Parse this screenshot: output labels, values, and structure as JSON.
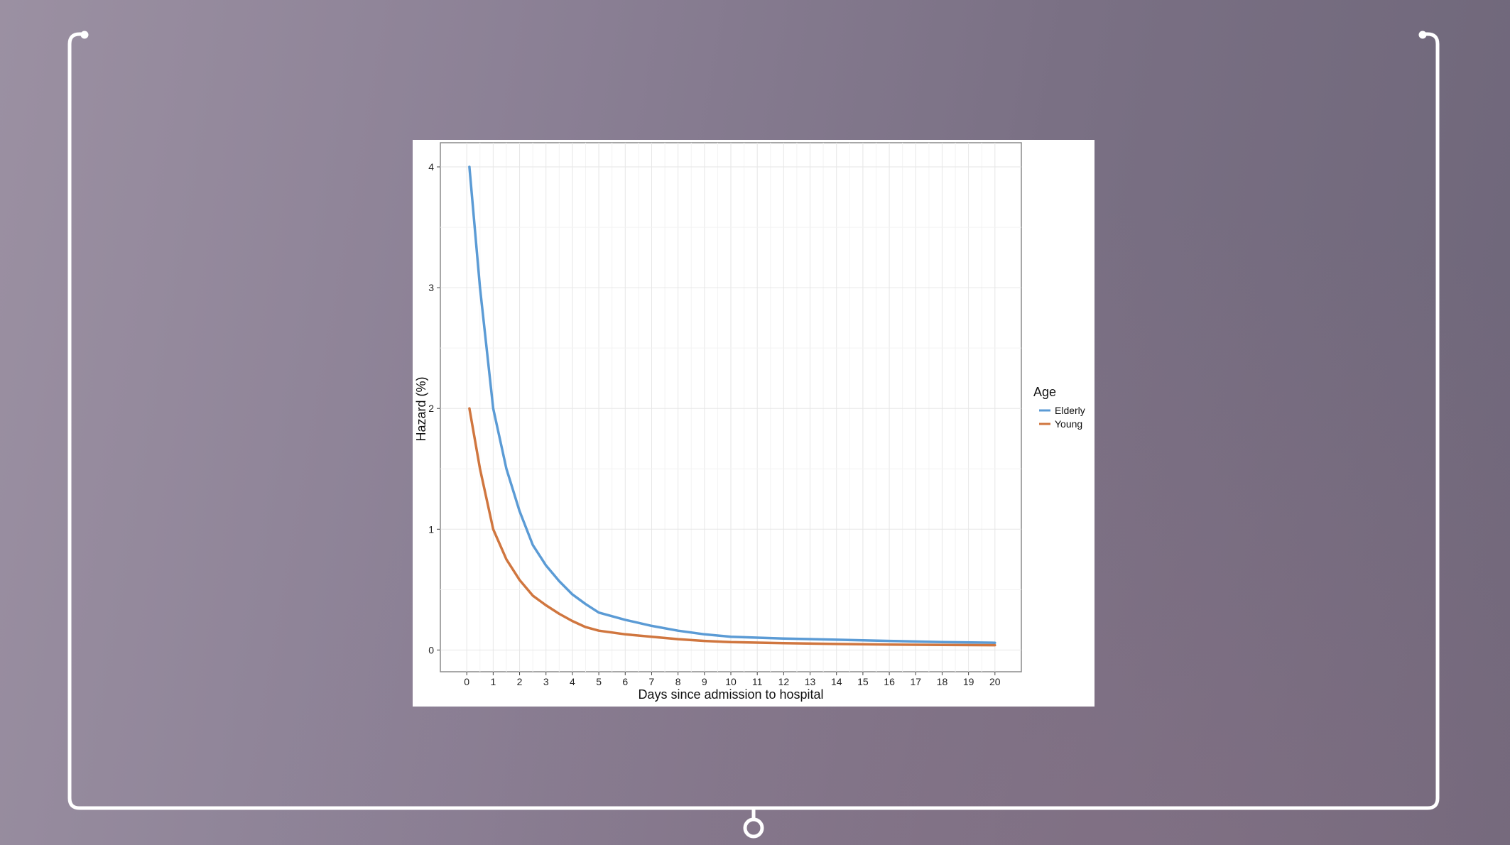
{
  "chart_data": {
    "type": "line",
    "title": "",
    "xlabel": "Days since admission to hospital",
    "ylabel": "Hazard (%)",
    "xlim": [
      -1,
      21
    ],
    "ylim": [
      -0.18,
      4.2
    ],
    "x_ticks": [
      0,
      1,
      2,
      3,
      4,
      5,
      6,
      7,
      8,
      9,
      10,
      11,
      12,
      13,
      14,
      15,
      16,
      17,
      18,
      19,
      20
    ],
    "y_ticks": [
      0,
      1,
      2,
      3,
      4
    ],
    "grid": true,
    "legend": {
      "title": "Age",
      "position": "right"
    },
    "series": [
      {
        "name": "Elderly",
        "color": "#5b9bd5",
        "x": [
          0.1,
          0.5,
          1,
          1.5,
          2,
          2.5,
          3,
          3.5,
          4,
          4.5,
          5,
          6,
          7,
          8,
          9,
          10,
          12,
          14,
          16,
          18,
          20
        ],
        "y": [
          4.0,
          3.0,
          2.0,
          1.5,
          1.15,
          0.87,
          0.7,
          0.57,
          0.46,
          0.38,
          0.31,
          0.25,
          0.2,
          0.16,
          0.13,
          0.11,
          0.095,
          0.085,
          0.075,
          0.065,
          0.06
        ]
      },
      {
        "name": "Young",
        "color": "#d0763f",
        "x": [
          0.1,
          0.5,
          1,
          1.5,
          2,
          2.5,
          3,
          3.5,
          4,
          4.5,
          5,
          6,
          7,
          8,
          9,
          10,
          12,
          14,
          16,
          18,
          20
        ],
        "y": [
          2.0,
          1.5,
          1.0,
          0.75,
          0.58,
          0.45,
          0.37,
          0.3,
          0.24,
          0.19,
          0.16,
          0.13,
          0.11,
          0.09,
          0.075,
          0.065,
          0.057,
          0.05,
          0.045,
          0.042,
          0.04
        ]
      }
    ]
  }
}
